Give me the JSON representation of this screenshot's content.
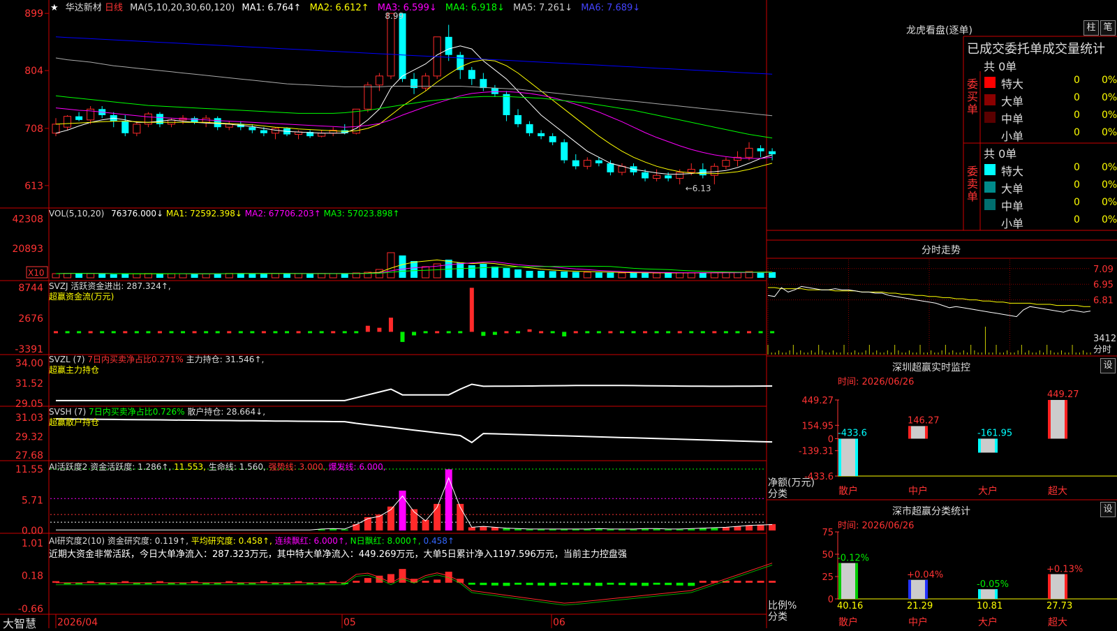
{
  "chart_data": {
    "type": "candlestick",
    "stock_name": "华达新材",
    "period_label": "日线",
    "price_axis_ticks": [
      "899",
      "804",
      "708",
      "613"
    ],
    "ylim": [
      5.85,
      9.05
    ],
    "date_axis_labels": [
      "2026/04",
      "05",
      "06"
    ],
    "annotations": [
      {
        "label": "8.99",
        "x": 28,
        "value": 8.99
      },
      {
        "label": "6.13",
        "x": 54,
        "value": 6.13
      }
    ],
    "candles": [
      {
        "o": 7.0,
        "h": 7.25,
        "l": 6.95,
        "c": 7.15
      },
      {
        "o": 7.1,
        "h": 7.3,
        "l": 7.05,
        "c": 7.28
      },
      {
        "o": 7.28,
        "h": 7.35,
        "l": 7.2,
        "c": 7.22
      },
      {
        "o": 7.22,
        "h": 7.45,
        "l": 7.15,
        "c": 7.4
      },
      {
        "o": 7.4,
        "h": 7.45,
        "l": 7.25,
        "c": 7.3
      },
      {
        "o": 7.3,
        "h": 7.35,
        "l": 7.1,
        "c": 7.2
      },
      {
        "o": 7.2,
        "h": 7.3,
        "l": 6.95,
        "c": 7.0
      },
      {
        "o": 7.0,
        "h": 7.2,
        "l": 6.95,
        "c": 7.15
      },
      {
        "o": 7.15,
        "h": 7.35,
        "l": 7.1,
        "c": 7.32
      },
      {
        "o": 7.32,
        "h": 7.35,
        "l": 7.1,
        "c": 7.15
      },
      {
        "o": 7.15,
        "h": 7.25,
        "l": 7.1,
        "c": 7.22
      },
      {
        "o": 7.22,
        "h": 7.3,
        "l": 7.15,
        "c": 7.25
      },
      {
        "o": 7.25,
        "h": 7.28,
        "l": 7.15,
        "c": 7.18
      },
      {
        "o": 7.18,
        "h": 7.3,
        "l": 7.1,
        "c": 7.25
      },
      {
        "o": 7.25,
        "h": 7.28,
        "l": 7.05,
        "c": 7.1
      },
      {
        "o": 7.1,
        "h": 7.2,
        "l": 7.05,
        "c": 7.15
      },
      {
        "o": 7.15,
        "h": 7.2,
        "l": 7.05,
        "c": 7.1
      },
      {
        "o": 7.1,
        "h": 7.15,
        "l": 7.0,
        "c": 7.05
      },
      {
        "o": 7.05,
        "h": 7.1,
        "l": 6.95,
        "c": 7.0
      },
      {
        "o": 7.0,
        "h": 7.1,
        "l": 6.9,
        "c": 7.08
      },
      {
        "o": 7.08,
        "h": 7.1,
        "l": 6.95,
        "c": 6.98
      },
      {
        "o": 6.98,
        "h": 7.05,
        "l": 6.9,
        "c": 7.02
      },
      {
        "o": 7.02,
        "h": 7.05,
        "l": 6.92,
        "c": 6.95
      },
      {
        "o": 6.95,
        "h": 7.05,
        "l": 6.93,
        "c": 7.0
      },
      {
        "o": 7.0,
        "h": 7.1,
        "l": 6.95,
        "c": 7.05
      },
      {
        "o": 7.05,
        "h": 7.15,
        "l": 6.98,
        "c": 7.0
      },
      {
        "o": 7.0,
        "h": 7.4,
        "l": 6.98,
        "c": 7.4
      },
      {
        "o": 7.4,
        "h": 7.85,
        "l": 7.35,
        "c": 7.8
      },
      {
        "o": 7.8,
        "h": 8.0,
        "l": 7.7,
        "c": 7.95
      },
      {
        "o": 7.95,
        "h": 8.99,
        "l": 7.9,
        "c": 8.99
      },
      {
        "o": 8.99,
        "h": 9.0,
        "l": 7.85,
        "c": 7.9
      },
      {
        "o": 7.9,
        "h": 8.0,
        "l": 7.65,
        "c": 7.75
      },
      {
        "o": 7.75,
        "h": 8.0,
        "l": 7.7,
        "c": 7.95
      },
      {
        "o": 7.95,
        "h": 8.6,
        "l": 7.9,
        "c": 8.6
      },
      {
        "o": 8.6,
        "h": 8.8,
        "l": 8.2,
        "c": 8.3
      },
      {
        "o": 8.3,
        "h": 8.35,
        "l": 7.9,
        "c": 8.05
      },
      {
        "o": 8.05,
        "h": 8.1,
        "l": 7.8,
        "c": 7.9
      },
      {
        "o": 7.9,
        "h": 8.0,
        "l": 7.7,
        "c": 7.75
      },
      {
        "o": 7.75,
        "h": 7.8,
        "l": 7.6,
        "c": 7.65
      },
      {
        "o": 7.65,
        "h": 7.7,
        "l": 7.2,
        "c": 7.3
      },
      {
        "o": 7.3,
        "h": 7.4,
        "l": 7.1,
        "c": 7.15
      },
      {
        "o": 7.15,
        "h": 7.2,
        "l": 6.95,
        "c": 7.0
      },
      {
        "o": 7.0,
        "h": 7.05,
        "l": 6.9,
        "c": 6.95
      },
      {
        "o": 6.95,
        "h": 7.0,
        "l": 6.8,
        "c": 6.85
      },
      {
        "o": 6.85,
        "h": 6.9,
        "l": 6.5,
        "c": 6.55
      },
      {
        "o": 6.55,
        "h": 6.65,
        "l": 6.4,
        "c": 6.45
      },
      {
        "o": 6.45,
        "h": 6.6,
        "l": 6.4,
        "c": 6.55
      },
      {
        "o": 6.55,
        "h": 6.6,
        "l": 6.45,
        "c": 6.5
      },
      {
        "o": 6.5,
        "h": 6.55,
        "l": 6.3,
        "c": 6.35
      },
      {
        "o": 6.35,
        "h": 6.5,
        "l": 6.3,
        "c": 6.45
      },
      {
        "o": 6.45,
        "h": 6.5,
        "l": 6.3,
        "c": 6.35
      },
      {
        "o": 6.35,
        "h": 6.4,
        "l": 6.2,
        "c": 6.25
      },
      {
        "o": 6.25,
        "h": 6.4,
        "l": 6.2,
        "c": 6.3
      },
      {
        "o": 6.3,
        "h": 6.35,
        "l": 6.2,
        "c": 6.25
      },
      {
        "o": 6.25,
        "h": 6.4,
        "l": 6.15,
        "c": 6.35
      },
      {
        "o": 6.35,
        "h": 6.5,
        "l": 6.3,
        "c": 6.4
      },
      {
        "o": 6.4,
        "h": 6.5,
        "l": 6.25,
        "c": 6.3
      },
      {
        "o": 6.3,
        "h": 6.5,
        "l": 6.15,
        "c": 6.45
      },
      {
        "o": 6.45,
        "h": 6.6,
        "l": 6.4,
        "c": 6.55
      },
      {
        "o": 6.55,
        "h": 6.7,
        "l": 6.45,
        "c": 6.6
      },
      {
        "o": 6.6,
        "h": 6.85,
        "l": 6.55,
        "c": 6.75
      },
      {
        "o": 6.75,
        "h": 6.8,
        "l": 6.6,
        "c": 6.7
      },
      {
        "o": 6.7,
        "h": 6.75,
        "l": 6.55,
        "c": 6.65
      }
    ],
    "ma_series": [
      {
        "name": "MA1",
        "color": "#ffffff",
        "values": [
          7.0,
          7.05,
          7.12,
          7.18,
          7.22,
          7.25,
          7.22,
          7.18,
          7.18,
          7.2,
          7.22,
          7.2,
          7.18,
          7.17,
          7.16,
          7.15,
          7.13,
          7.11,
          7.08,
          7.05,
          7.03,
          7.02,
          7.01,
          7.0,
          7.0,
          7.0,
          7.08,
          7.22,
          7.4,
          7.75,
          7.95,
          8.05,
          8.15,
          8.3,
          8.4,
          8.45,
          8.4,
          8.2,
          8.05,
          7.9,
          7.7,
          7.5,
          7.3,
          7.15,
          7.0,
          6.85,
          6.7,
          6.6,
          6.5,
          6.45,
          6.4,
          6.37,
          6.34,
          6.32,
          6.32,
          6.33,
          6.35,
          6.36,
          6.38,
          6.43,
          6.5,
          6.58,
          6.64
        ]
      },
      {
        "name": "MA2",
        "color": "#ffff00",
        "values": [
          7.15,
          7.16,
          7.17,
          7.18,
          7.19,
          7.2,
          7.2,
          7.19,
          7.18,
          7.18,
          7.18,
          7.18,
          7.18,
          7.18,
          7.17,
          7.16,
          7.15,
          7.14,
          7.12,
          7.1,
          7.09,
          7.07,
          7.06,
          7.05,
          7.04,
          7.03,
          7.04,
          7.08,
          7.15,
          7.3,
          7.45,
          7.58,
          7.7,
          7.85,
          7.98,
          8.1,
          8.18,
          8.22,
          8.2,
          8.12,
          8.0,
          7.85,
          7.7,
          7.55,
          7.4,
          7.25,
          7.1,
          6.95,
          6.82,
          6.7,
          6.6,
          6.52,
          6.45,
          6.4,
          6.36,
          6.34,
          6.33,
          6.33,
          6.34,
          6.36,
          6.4,
          6.45,
          6.5
        ]
      },
      {
        "name": "MA3",
        "color": "#ff00ff",
        "values": [
          7.42,
          7.4,
          7.38,
          7.37,
          7.35,
          7.33,
          7.31,
          7.29,
          7.27,
          7.26,
          7.25,
          7.24,
          7.23,
          7.22,
          7.21,
          7.2,
          7.19,
          7.18,
          7.17,
          7.16,
          7.15,
          7.14,
          7.13,
          7.12,
          7.11,
          7.1,
          7.11,
          7.13,
          7.16,
          7.22,
          7.3,
          7.37,
          7.44,
          7.5,
          7.56,
          7.62,
          7.66,
          7.68,
          7.69,
          7.69,
          7.68,
          7.66,
          7.63,
          7.59,
          7.54,
          7.48,
          7.42,
          7.35,
          7.27,
          7.19,
          7.1,
          7.01,
          6.93,
          6.86,
          6.79,
          6.73,
          6.68,
          6.64,
          6.61,
          6.59,
          6.58,
          6.58,
          6.6
        ]
      },
      {
        "name": "MA4",
        "color": "#00ff00",
        "values": [
          7.62,
          7.6,
          7.58,
          7.56,
          7.54,
          7.52,
          7.5,
          7.48,
          7.46,
          7.45,
          7.44,
          7.43,
          7.42,
          7.41,
          7.4,
          7.39,
          7.38,
          7.37,
          7.36,
          7.35,
          7.34,
          7.33,
          7.33,
          7.33,
          7.33,
          7.34,
          7.36,
          7.38,
          7.41,
          7.44,
          7.47,
          7.5,
          7.53,
          7.55,
          7.57,
          7.59,
          7.6,
          7.61,
          7.61,
          7.61,
          7.6,
          7.59,
          7.58,
          7.56,
          7.54,
          7.52,
          7.5,
          7.47,
          7.44,
          7.41,
          7.38,
          7.34,
          7.3,
          7.26,
          7.22,
          7.18,
          7.14,
          7.1,
          7.06,
          7.02,
          6.98,
          6.95,
          6.92
        ]
      },
      {
        "name": "MA5",
        "color": "#aaaaaa",
        "values": [
          8.25,
          8.22,
          8.2,
          8.18,
          8.15,
          8.12,
          8.1,
          8.08,
          8.06,
          8.04,
          8.02,
          8.0,
          7.98,
          7.96,
          7.94,
          7.92,
          7.9,
          7.88,
          7.86,
          7.84,
          7.82,
          7.81,
          7.8,
          7.79,
          7.78,
          7.77,
          7.77,
          7.77,
          7.77,
          7.78,
          7.78,
          7.78,
          7.78,
          7.78,
          7.78,
          7.78,
          7.77,
          7.76,
          7.75,
          7.74,
          7.73,
          7.71,
          7.69,
          7.67,
          7.65,
          7.63,
          7.61,
          7.59,
          7.57,
          7.55,
          7.53,
          7.51,
          7.49,
          7.47,
          7.45,
          7.43,
          7.41,
          7.39,
          7.37,
          7.35,
          7.33,
          7.31,
          7.29
        ]
      },
      {
        "name": "MA6",
        "color": "#0000ff",
        "values": [
          8.6,
          8.59,
          8.58,
          8.57,
          8.56,
          8.55,
          8.54,
          8.53,
          8.52,
          8.51,
          8.5,
          8.49,
          8.48,
          8.47,
          8.46,
          8.45,
          8.44,
          8.43,
          8.42,
          8.41,
          8.4,
          8.39,
          8.38,
          8.37,
          8.36,
          8.35,
          8.34,
          8.33,
          8.32,
          8.31,
          8.3,
          8.29,
          8.28,
          8.27,
          8.26,
          8.25,
          8.24,
          8.23,
          8.22,
          8.21,
          8.2,
          8.19,
          8.18,
          8.17,
          8.16,
          8.15,
          8.14,
          8.13,
          8.12,
          8.11,
          8.1,
          8.09,
          8.08,
          8.07,
          8.06,
          8.05,
          8.04,
          8.03,
          8.02,
          8.01,
          8.0,
          7.99,
          7.98
        ]
      }
    ],
    "volume": {
      "axis_ticks": [
        "42308",
        "20893"
      ],
      "unit_badge": "X10",
      "values": [
        3000,
        3200,
        3500,
        3000,
        2800,
        2600,
        2800,
        3000,
        3100,
        3000,
        2900,
        2900,
        2800,
        3000,
        3100,
        3200,
        3300,
        3100,
        3000,
        3200,
        3100,
        3000,
        3000,
        3100,
        3000,
        3200,
        3500,
        4000,
        6000,
        18000,
        16000,
        12000,
        8000,
        10000,
        13000,
        11000,
        9000,
        10000,
        8000,
        7000,
        6000,
        5000,
        5000,
        4800,
        4500,
        4200,
        4000,
        3800,
        3700,
        3500,
        3600,
        3500,
        3400,
        3600,
        3500,
        3600,
        3800,
        3700,
        3900,
        4000,
        4500,
        4200,
        4100
      ]
    },
    "svzj_bars": [
      0,
      0,
      0,
      0,
      0,
      0,
      0,
      0,
      0,
      0,
      0,
      0,
      0,
      0,
      0,
      0,
      0,
      0,
      0,
      0,
      0,
      0,
      0,
      0,
      0,
      0,
      0,
      1200,
      800,
      2800,
      -2000,
      -700,
      0,
      0,
      0,
      0,
      8700,
      -800,
      -600,
      0,
      0,
      500,
      0,
      0,
      -900,
      0,
      0,
      0,
      0,
      0,
      0,
      0,
      0,
      0,
      0,
      0,
      0,
      0,
      0,
      0,
      0,
      0,
      0
    ]
  },
  "header": {
    "star": "★",
    "stock_name": "华达新材",
    "period": "日线",
    "ma_def": "MA(5,10,20,30,60,120)",
    "ma1": "MA1: 6.764↑",
    "ma2": "MA2: 6.612↑",
    "ma3": "MA3: 6.599↓",
    "ma4": "MA4: 6.918↓",
    "ma5": "MA5: 7.261↓",
    "ma6": "MA6: 7.689↓"
  },
  "vol_header": {
    "def": "VOL(5,10,20)",
    "v": "76376.000↓",
    "ma1": "MA1: 72592.398↓",
    "ma2": "MA2: 67706.203↑",
    "ma3": "MA3: 57023.898↑"
  },
  "svzj": {
    "line1": "SVZJ  活跃资金进出: 287.324↑,",
    "line2": "超赢资金流(万元)",
    "ticks": [
      "8744",
      "2676",
      "-3391"
    ]
  },
  "svzl": {
    "prefix": "SVZL (7) ",
    "ratio": "7日内买卖净占比0.271%",
    "holding": "主力持仓: 31.546↑,",
    "line2": "超赢主力持仓",
    "ticks": [
      "34.00",
      "31.52",
      "29.05"
    ]
  },
  "svsh": {
    "prefix": "SVSH (7) ",
    "ratio": "7日内买卖净占比0.726%",
    "holding": "散户持仓: 28.664↓,",
    "line2": "超赢散户持仓",
    "ticks": [
      "31.03",
      "29.32",
      "27.68"
    ]
  },
  "ai_active": {
    "name": "AI活跃度2",
    "active": "资金活跃度: 1.286↑,",
    "v2": "11.553,",
    "life": "生命线: 1.560,",
    "strong": "强势线: 3.000,",
    "burst": "爆发线: 6.000,",
    "ticks": [
      "11.55",
      "5.71",
      "0.00"
    ]
  },
  "ai_research": {
    "name": "AI研究度2(10)",
    "research": "资金研究度: 0.119↑,",
    "avg": "平均研究度: 0.458↑,",
    "red": "连续飘红: 6.000↑,",
    "nred": "N日飘红: 8.000↑,",
    "last": "0.458↑",
    "summary": "近期大资金非常活跃，今日大单净流入：287.323万元，其中特大单净流入：449.269万元，大单5日累计净入1197.596万元，当前主力控盘强",
    "ticks": [
      "1.01",
      "0.18",
      "-0.66"
    ]
  },
  "footer": {
    "brand": "大智慧"
  },
  "dragon": {
    "title": "龙虎看盘(逐单)",
    "btn_col": "柱",
    "btn_pen": "笔",
    "subtitle": "已成交委托单成交量统计",
    "buy_side": "委买单",
    "sell_side": "委卖单",
    "buy_total": "共 0单",
    "sell_total": "共 0单",
    "categories": [
      "特大",
      "大单",
      "中单",
      "小单"
    ],
    "buy_vals": [
      "0",
      "0",
      "0",
      "0"
    ],
    "buy_pct": [
      "0%",
      "0%",
      "0%",
      "0%"
    ],
    "sell_vals": [
      "0",
      "0",
      "0",
      "0"
    ],
    "sell_pct": [
      "0%",
      "0%",
      "0%",
      "0%"
    ],
    "buy_colors": [
      "#ff0000",
      "#8b0000",
      "#5a0000",
      "#000000"
    ],
    "sell_colors": [
      "#00ffff",
      "#008b8b",
      "#006e6e",
      "#000000"
    ]
  },
  "intraday": {
    "title": "分时走势",
    "price_ticks": [
      "7.09",
      "6.95",
      "6.81"
    ],
    "vol_tick": "3412",
    "vol_label": "分时",
    "price": [
      6.85,
      6.84,
      6.92,
      6.88,
      6.9,
      6.93,
      6.92,
      6.91,
      6.9,
      6.9,
      6.91,
      6.9,
      6.9,
      6.89,
      6.88,
      6.88,
      6.87,
      6.87,
      6.85,
      6.84,
      6.83,
      6.82,
      6.81,
      6.8,
      6.79,
      6.78,
      6.76,
      6.74,
      6.75,
      6.74,
      6.73,
      6.72,
      6.71,
      6.7,
      6.69,
      6.68,
      6.67,
      6.66,
      6.72,
      6.75,
      6.74,
      6.73,
      6.72,
      6.71,
      6.7,
      6.72,
      6.71,
      6.7,
      6.71
    ],
    "avg": [
      6.92,
      6.92,
      6.91,
      6.91,
      6.91,
      6.91,
      6.9,
      6.9,
      6.9,
      6.9,
      6.89,
      6.89,
      6.89,
      6.89,
      6.88,
      6.88,
      6.88,
      6.88,
      6.87,
      6.87,
      6.86,
      6.86,
      6.85,
      6.85,
      6.84,
      6.84,
      6.83,
      6.83,
      6.82,
      6.82,
      6.81,
      6.81,
      6.8,
      6.8,
      6.79,
      6.79,
      6.78,
      6.78,
      6.78,
      6.78,
      6.77,
      6.77,
      6.77,
      6.76,
      6.76,
      6.76,
      6.76,
      6.75,
      6.75
    ]
  },
  "sz_monitor": {
    "title": "深圳超赢实时监控",
    "btn": "设",
    "time": "时间: 2026/06/26",
    "ticks": [
      "449.27",
      "154.95",
      "0",
      "-139.31",
      "-433.6"
    ],
    "ylabel": "净额(万元)",
    "xlabel": "分类",
    "categories": [
      "散户",
      "中户",
      "大户",
      "超大"
    ],
    "values": [
      -433.6,
      146.27,
      -161.95,
      449.27
    ],
    "labels": [
      "-433.6",
      "146.27",
      "-161.95",
      "449.27"
    ],
    "ylim": [
      -433.6,
      449.27
    ]
  },
  "sz_stats": {
    "title": "深市超赢分类统计",
    "btn": "设",
    "time": "时间: 2026/06/26",
    "ticks": [
      "75",
      "50",
      "25",
      "0"
    ],
    "ylabel": "比例%",
    "xlabel": "分类",
    "categories": [
      "散户",
      "中户",
      "大户",
      "超大"
    ],
    "values": [
      40.16,
      21.29,
      10.81,
      27.73
    ],
    "top_labels": [
      "-0.12%",
      "+0.04%",
      "-0.05%",
      "+0.13%"
    ],
    "bottom_labels": [
      "40.16",
      "21.29",
      "10.81",
      "27.73"
    ],
    "colors": [
      "#00cc00",
      "#2233ff",
      "#00ffff",
      "#ff2222"
    ],
    "ylim": [
      0,
      75
    ]
  }
}
